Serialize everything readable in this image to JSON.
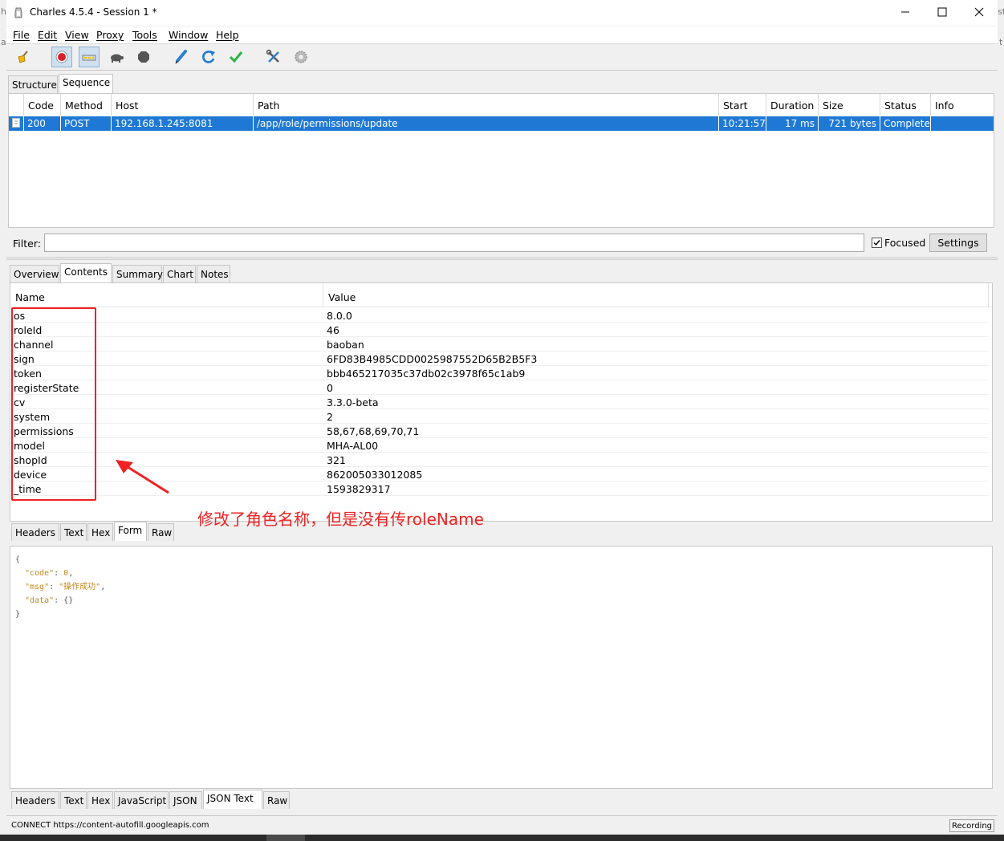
{
  "window": {
    "title": "Charles 4.5.4 - Session 1 *",
    "edge_left_chars": [
      "h",
      "a"
    ],
    "edge_right_chars": [
      "st",
      "t"
    ]
  },
  "menu": [
    "File",
    "Edit",
    "View",
    "Proxy",
    "Tools",
    "Window",
    "Help"
  ],
  "toolbar": {
    "icons": [
      "broom-icon",
      "record-icon",
      "throttle-icon",
      "turtle-icon",
      "stop-icon",
      "pen-icon",
      "refresh-icon",
      "check-icon",
      "tools-icon",
      "settings-gear-icon"
    ]
  },
  "view_tabs": [
    "Structure",
    "Sequence"
  ],
  "sequence": {
    "columns": [
      "Code",
      "Method",
      "Host",
      "Path",
      "Start",
      "Duration",
      "Size",
      "Status",
      "Info"
    ],
    "rows": [
      {
        "code": "200",
        "method": "POST",
        "host": "192.168.1.245:8081",
        "path": "/app/role/permissions/update",
        "start": "10:21:57",
        "duration": "17 ms",
        "size": "721 bytes",
        "status": "Complete",
        "info": ""
      }
    ]
  },
  "filter": {
    "label": "Filter:",
    "value": "",
    "focused_label": "Focused",
    "focused_checked": true,
    "settings_label": "Settings"
  },
  "detail_tabs": [
    "Overview",
    "Contents",
    "Summary",
    "Chart",
    "Notes"
  ],
  "form": {
    "columns": [
      "Name",
      "Value"
    ],
    "rows": [
      {
        "name": "os",
        "value": "8.0.0"
      },
      {
        "name": "roleId",
        "value": "46"
      },
      {
        "name": "channel",
        "value": "baoban"
      },
      {
        "name": "sign",
        "value": "6FD83B4985CDD0025987552D65B2B5F3"
      },
      {
        "name": "token",
        "value": "bbb465217035c37db02c3978f65c1ab9"
      },
      {
        "name": "registerState",
        "value": "0"
      },
      {
        "name": "cv",
        "value": "3.3.0-beta"
      },
      {
        "name": "system",
        "value": "2"
      },
      {
        "name": "permissions",
        "value": "58,67,68,69,70,71"
      },
      {
        "name": "model",
        "value": "MHA-AL00"
      },
      {
        "name": "shopId",
        "value": "321"
      },
      {
        "name": "device",
        "value": "862005033012085"
      },
      {
        "name": "_time",
        "value": "1593829317"
      }
    ]
  },
  "annotation": {
    "text": "修改了角色名称，但是没有传roleName",
    "color": "#ee2222"
  },
  "request_tabs": [
    "Headers",
    "Text",
    "Hex",
    "Form",
    "Raw"
  ],
  "request_tab_active": "Form",
  "response_json": {
    "open": "{",
    "close": "}",
    "lines": [
      {
        "key": "\"code\"",
        "value": "0",
        "trail": ","
      },
      {
        "key": "\"msg\"",
        "value": "\"操作成功\"",
        "trail": ","
      },
      {
        "key": "\"data\"",
        "value": "{}",
        "trail": ""
      }
    ]
  },
  "response_tabs": [
    "Headers",
    "Text",
    "Hex",
    "JavaScript",
    "JSON",
    "JSON Text",
    "Raw"
  ],
  "response_tab_active": "JSON Text",
  "status": {
    "text": "CONNECT https://content-autofill.googleapis.com",
    "recording": "Recording"
  },
  "colors": {
    "selection": "#1f79d4",
    "record": "#d8202a",
    "annotation": "#ee2222",
    "json_key": "#c7861d"
  }
}
